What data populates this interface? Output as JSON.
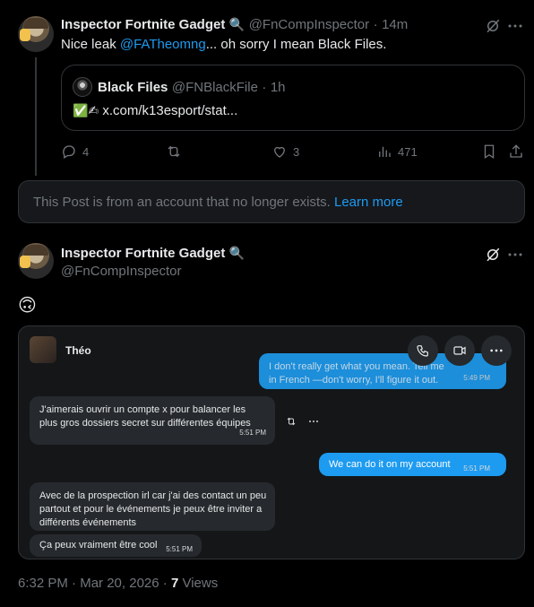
{
  "tweet1": {
    "author_name": "Inspector Fortnite Gadget",
    "author_emoji": "🔍",
    "handle": "@FnCompInspector",
    "dot": "·",
    "time": "14m",
    "text_before": "Nice leak ",
    "mention": "@FATheomng",
    "text_after": "... oh sorry I mean Black Files.",
    "quote": {
      "author_name": "Black Files",
      "handle": "@FNBlackFile",
      "dot": "·",
      "time": "1h",
      "emojis": "✅✍",
      "link_text": "x.com/k13esport/stat..."
    },
    "actions": {
      "replies": "4",
      "reposts": "",
      "likes": "3",
      "views": "471"
    }
  },
  "removed_notice": {
    "text": "This Post is from an account that no longer exists.",
    "link": "Learn more"
  },
  "tweet2": {
    "author_name": "Inspector Fortnite Gadget",
    "author_emoji": "🔍",
    "handle": "@FnCompInspector",
    "emoji_text": "🙃",
    "screenshot": {
      "contact_name": "Théo",
      "messages": [
        {
          "side": "right",
          "text": "I don't really get what you mean. Tell me in French —don't worry, I'll figure it out.",
          "time": "5:49 PM"
        },
        {
          "side": "left",
          "text": "J'aimerais ouvrir un compte x pour balancer les plus gros dossiers secret sur différentes équipes",
          "time": "5:51 PM"
        },
        {
          "side": "right",
          "text": "We can do it on my account",
          "time": "5:51 PM"
        },
        {
          "side": "left",
          "text": "Avec de la prospection irl car j'ai des contact un peu partout et pour le événements je peux être inviter a différents événements",
          "time": ""
        },
        {
          "side": "left",
          "text": "Ça peux vraiment être cool",
          "time": "5:51 PM"
        }
      ]
    },
    "footer": {
      "time": "6:32 PM",
      "dot": "·",
      "date": "Mar 20, 2026",
      "dot2": "·",
      "views_count": "7",
      "views_label": "Views"
    }
  }
}
